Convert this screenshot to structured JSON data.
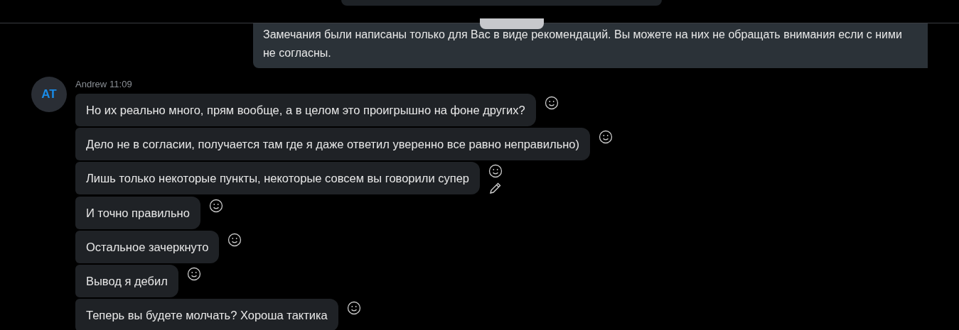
{
  "own_message": {
    "text": "Замечания были написаны только для Вас в виде рекомендаций. Вы можете на них не обращать внимания если с ними не согласны."
  },
  "group": {
    "avatar": "AT",
    "author": "Andrew",
    "time": "11:09",
    "messages": [
      {
        "text": "Но их реально много, прям вообще, а в целом это проигрышно на фоне других?",
        "editable": false
      },
      {
        "text": "Дело не в согласии, получается там где я даже ответил уверенно все равно неправильно)",
        "editable": false
      },
      {
        "text": "Лишь только некоторые пункты, некоторые совсем вы говорили супер",
        "editable": true
      },
      {
        "text": "И точно правильно",
        "editable": false
      },
      {
        "text": "Остальное зачеркнуто",
        "editable": false
      },
      {
        "text": "Вывод я дебил",
        "editable": false
      },
      {
        "text": "Теперь вы будете молчать? Хороша тактика",
        "editable": false
      }
    ]
  }
}
